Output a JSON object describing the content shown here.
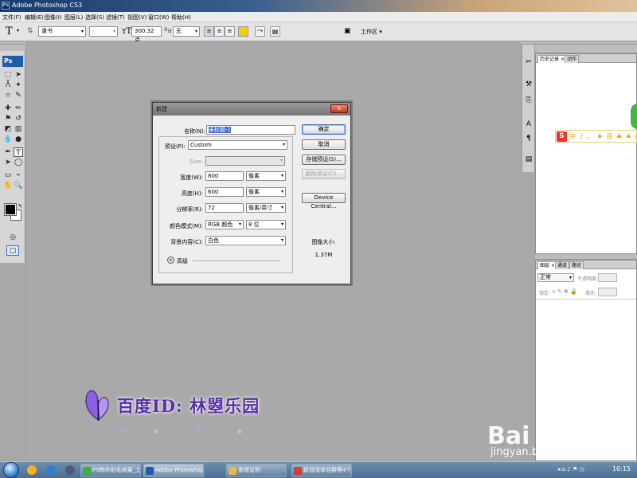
{
  "window": {
    "title": "Adobe Photoshop CS3",
    "app_badge": "Ps"
  },
  "menu": [
    "文件(F)",
    "编辑(E)",
    "图像(I)",
    "图层(L)",
    "选择(S)",
    "滤镜(T)",
    "视图(V)",
    "窗口(W)",
    "帮助(H)"
  ],
  "options": {
    "tool_glyph": "T",
    "font_family": "隶书",
    "font_style": "-",
    "font_size": "300.32 点",
    "antialias": "无",
    "workspace_label": "工作区",
    "color": "#f0d000"
  },
  "tools_panel": {
    "logo": "Ps"
  },
  "right_panels": {
    "history_tabs": [
      "历史记录",
      "动作"
    ],
    "layers_tabs": [
      "图层",
      "通道",
      "路径"
    ],
    "blend_mode": "正常",
    "opacity_label": "不透明度:",
    "lock_label": "锁定:",
    "fill_label": "填充:"
  },
  "ime": {
    "badge": "S",
    "text": "中 ♪ 。 ♦ 目 ♣ ♠ ⊞"
  },
  "dialog": {
    "title": "新建",
    "close": "x",
    "name_label": "名称(N):",
    "name_value": "未标题-1",
    "preset_label": "预设(P):",
    "preset_value": "Custom",
    "size_label": "Size:",
    "width_label": "宽度(W):",
    "width_value": "800",
    "width_unit": "像素",
    "height_label": "高度(H):",
    "height_value": "600",
    "height_unit": "像素",
    "resolution_label": "分辨率(R):",
    "resolution_value": "72",
    "resolution_unit": "像素/英寸",
    "mode_label": "颜色模式(M):",
    "mode_value": "RGB 颜色",
    "bits_value": "8 位",
    "bg_label": "背景内容(C):",
    "bg_value": "白色",
    "advanced_label": "高级",
    "ok": "确定",
    "cancel": "取消",
    "save_preset": "存储预设(S)...",
    "delete_preset": "删除预设(D)...",
    "device_central": "Device Central...",
    "image_size_label": "图像大小:",
    "image_size_value": "1.37M"
  },
  "watermark": {
    "text": "百度ID: 林曌乐园"
  },
  "brand": {
    "name": "Bai 经验",
    "url": "jingyan.baidu.com"
  },
  "taskbar": {
    "items": [
      "PS制作彩毛效果_土...",
      "Adobe Photoshop ...",
      "参观证明",
      "新冠深体验群等4个..."
    ],
    "clock": "16:15"
  }
}
